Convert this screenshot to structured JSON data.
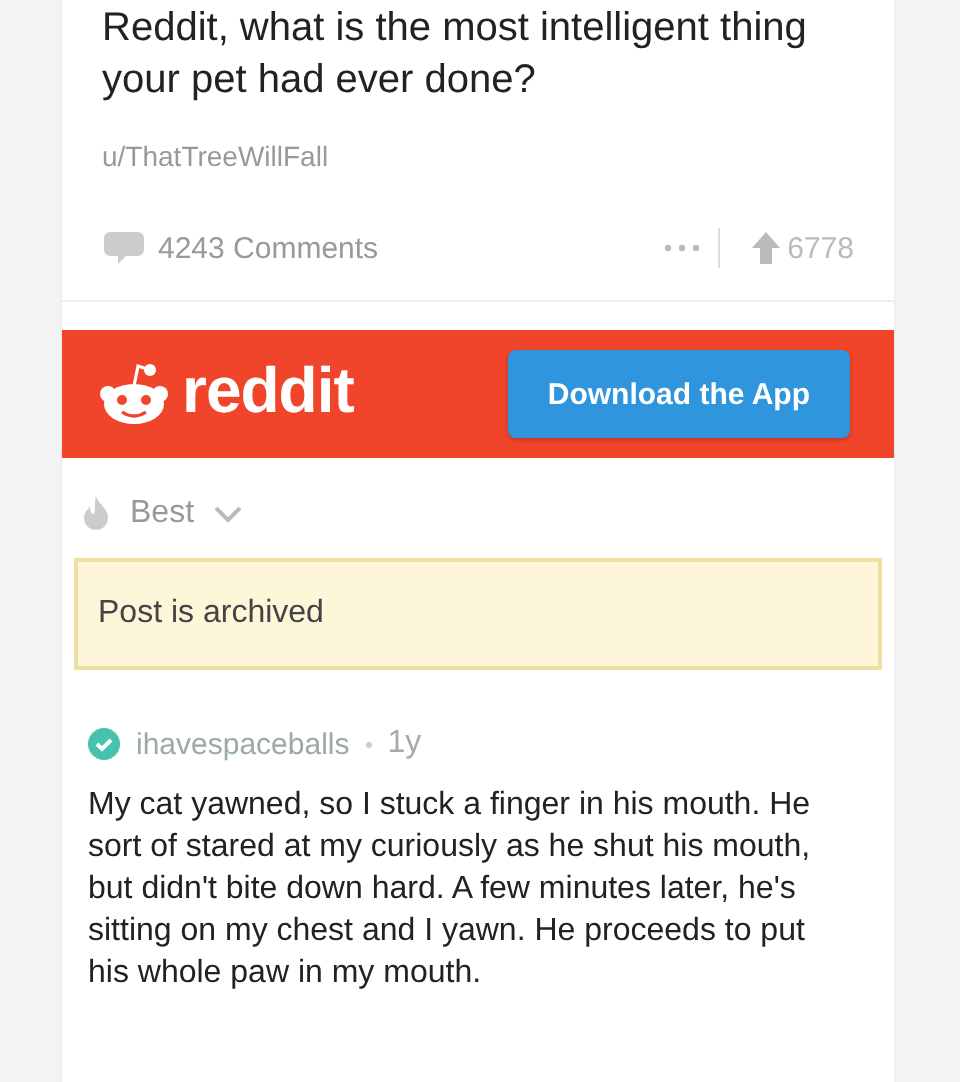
{
  "post": {
    "title": "Reddit, what is the most intelligent thing your pet had ever done?",
    "author": "u/ThatTreeWillFall",
    "comments": "4243 Comments",
    "score": "6778"
  },
  "banner": {
    "brand": "reddit",
    "button": "Download the App"
  },
  "sort": {
    "label": "Best"
  },
  "notice": "Post is archived",
  "comments": [
    {
      "author": "ihavespaceballs",
      "verified": true,
      "age": "1y",
      "body": "My cat yawned, so I stuck a finger in his mouth. He sort of stared at my curiously as he shut his mouth, but didn't bite down hard. A few minutes later, he's sitting on my chest and I yawn. He proceeds to put his whole paw in my mouth."
    }
  ]
}
